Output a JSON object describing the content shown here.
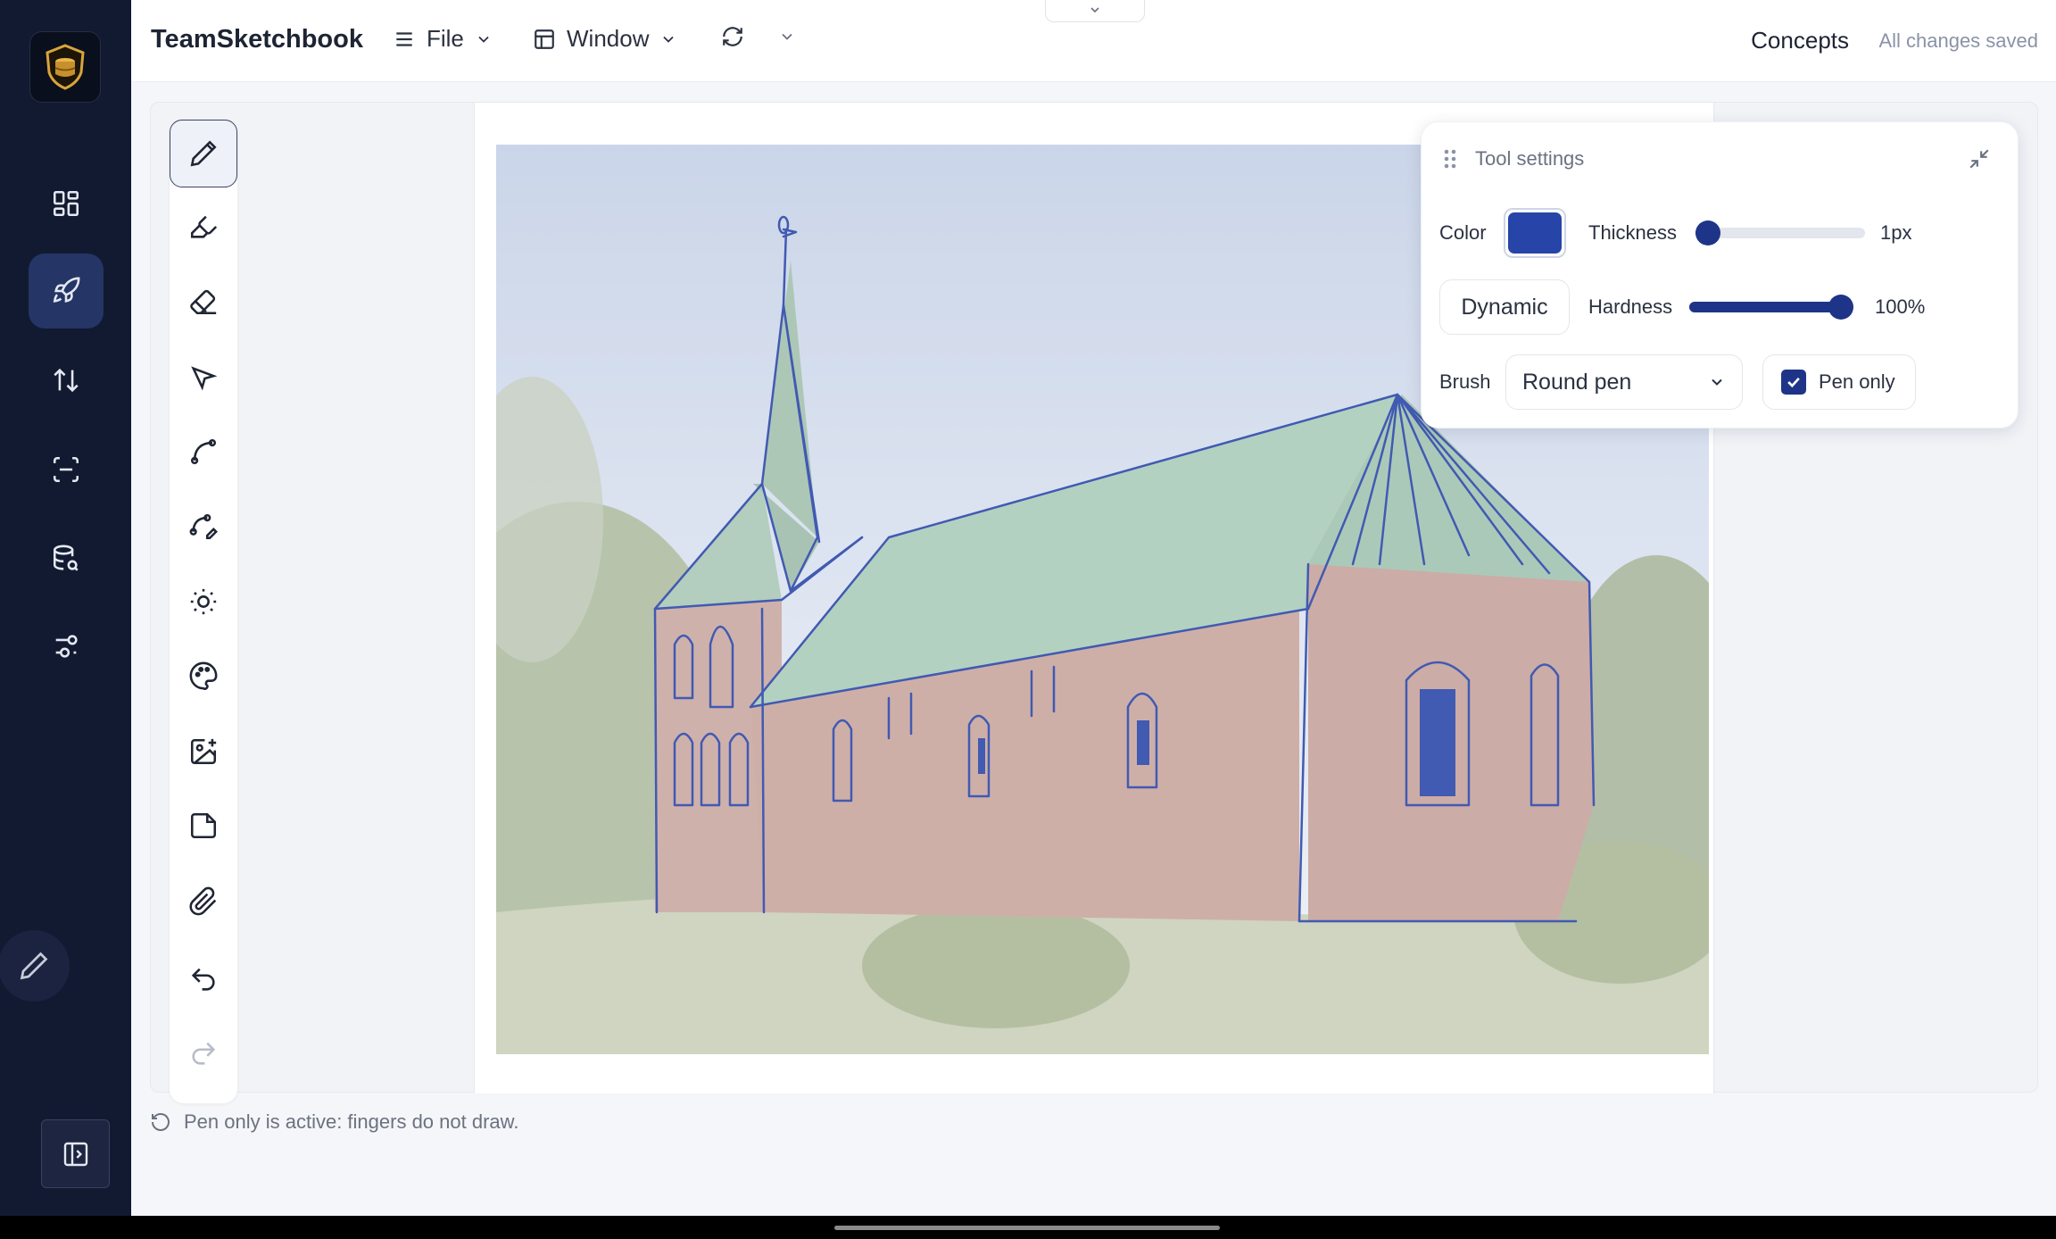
{
  "app": {
    "title": "TeamSketchbook",
    "project": "Concepts",
    "save_status": "All changes saved"
  },
  "menus": {
    "file": "File",
    "window": "Window"
  },
  "nav": {
    "items": [
      {
        "name": "dashboard-icon",
        "active": false
      },
      {
        "name": "rocket-icon",
        "active": true
      },
      {
        "name": "sort-arrows-icon",
        "active": false
      },
      {
        "name": "scan-icon",
        "active": false
      },
      {
        "name": "database-search-icon",
        "active": false
      },
      {
        "name": "sliders-icon",
        "active": false
      }
    ]
  },
  "tools": [
    {
      "name": "pencil-tool",
      "active": true
    },
    {
      "name": "highlighter-tool"
    },
    {
      "name": "eraser-tool"
    },
    {
      "name": "select-pointer-tool"
    },
    {
      "name": "curve-tool"
    },
    {
      "name": "curve-edit-tool"
    },
    {
      "name": "brightness-tool"
    },
    {
      "name": "palette-tool"
    },
    {
      "name": "add-image-tool"
    },
    {
      "name": "sticky-note-tool"
    },
    {
      "name": "attachment-tool"
    },
    {
      "name": "undo-tool"
    },
    {
      "name": "redo-tool",
      "disabled": true
    }
  ],
  "tool_settings": {
    "title": "Tool settings",
    "color_label": "Color",
    "color_value": "#2744a8",
    "thickness_label": "Thickness",
    "thickness_value": "1px",
    "thickness_level": 0.0,
    "dynamic_label": "Dynamic",
    "hardness_label": "Hardness",
    "hardness_value": "100%",
    "hardness_level": 1.0,
    "brush_label": "Brush",
    "brush_value": "Round pen",
    "pen_only_label": "Pen only",
    "pen_only_checked": true
  },
  "status": {
    "message": "Pen only is active: fingers do not draw."
  },
  "colors": {
    "accent": "#1d3488",
    "nav_bg": "#121a31",
    "ink": "#2744a8"
  }
}
